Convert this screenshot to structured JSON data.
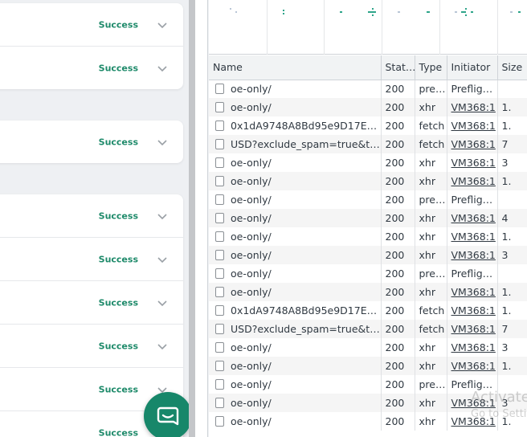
{
  "left_panel": {
    "status_items": [
      "Success",
      "Success",
      "Success",
      "Success",
      "Success",
      "Success",
      "Success",
      "Success",
      "Success"
    ],
    "accent_color": "#1e8a6a",
    "chat_button_color": "#17876a"
  },
  "network": {
    "columns": [
      "Name",
      "Stat…",
      "Type",
      "Initiator",
      "Size"
    ],
    "rows": [
      {
        "name": "oe-only/",
        "status": "200",
        "type": "pre…",
        "initiator": "Prefligh…",
        "size": ""
      },
      {
        "name": "oe-only/",
        "status": "200",
        "type": "xhr",
        "initiator": "VM368:1",
        "size": "1."
      },
      {
        "name": "0x1dA9748A8Bd95e9D17E7B…",
        "status": "200",
        "type": "fetch",
        "initiator": "VM368:1",
        "size": "1."
      },
      {
        "name": "USD?exclude_spam=true&tr…",
        "status": "200",
        "type": "fetch",
        "initiator": "VM368:1",
        "size": "7"
      },
      {
        "name": "oe-only/",
        "status": "200",
        "type": "xhr",
        "initiator": "VM368:1",
        "size": "3"
      },
      {
        "name": "oe-only/",
        "status": "200",
        "type": "xhr",
        "initiator": "VM368:1",
        "size": "1."
      },
      {
        "name": "oe-only/",
        "status": "200",
        "type": "pre…",
        "initiator": "Prefligh…",
        "size": ""
      },
      {
        "name": "oe-only/",
        "status": "200",
        "type": "xhr",
        "initiator": "VM368:1",
        "size": "4"
      },
      {
        "name": "oe-only/",
        "status": "200",
        "type": "xhr",
        "initiator": "VM368:1",
        "size": "1."
      },
      {
        "name": "oe-only/",
        "status": "200",
        "type": "xhr",
        "initiator": "VM368:1",
        "size": "3"
      },
      {
        "name": "oe-only/",
        "status": "200",
        "type": "pre…",
        "initiator": "Prefligh…",
        "size": ""
      },
      {
        "name": "oe-only/",
        "status": "200",
        "type": "xhr",
        "initiator": "VM368:1",
        "size": "1."
      },
      {
        "name": "0x1dA9748A8Bd95e9D17E7B…",
        "status": "200",
        "type": "fetch",
        "initiator": "VM368:1",
        "size": "1."
      },
      {
        "name": "USD?exclude_spam=true&tr…",
        "status": "200",
        "type": "fetch",
        "initiator": "VM368:1",
        "size": "7"
      },
      {
        "name": "oe-only/",
        "status": "200",
        "type": "xhr",
        "initiator": "VM368:1",
        "size": "3"
      },
      {
        "name": "oe-only/",
        "status": "200",
        "type": "xhr",
        "initiator": "VM368:1",
        "size": "1."
      },
      {
        "name": "oe-only/",
        "status": "200",
        "type": "pre…",
        "initiator": "Prefligh…",
        "size": ""
      },
      {
        "name": "oe-only/",
        "status": "200",
        "type": "xhr",
        "initiator": "VM368:1",
        "size": "3"
      },
      {
        "name": "oe-only/",
        "status": "200",
        "type": "xhr",
        "initiator": "VM368:1",
        "size": "1."
      }
    ]
  },
  "watermark": {
    "line1": "Activate",
    "line2": "Go to Setti"
  }
}
